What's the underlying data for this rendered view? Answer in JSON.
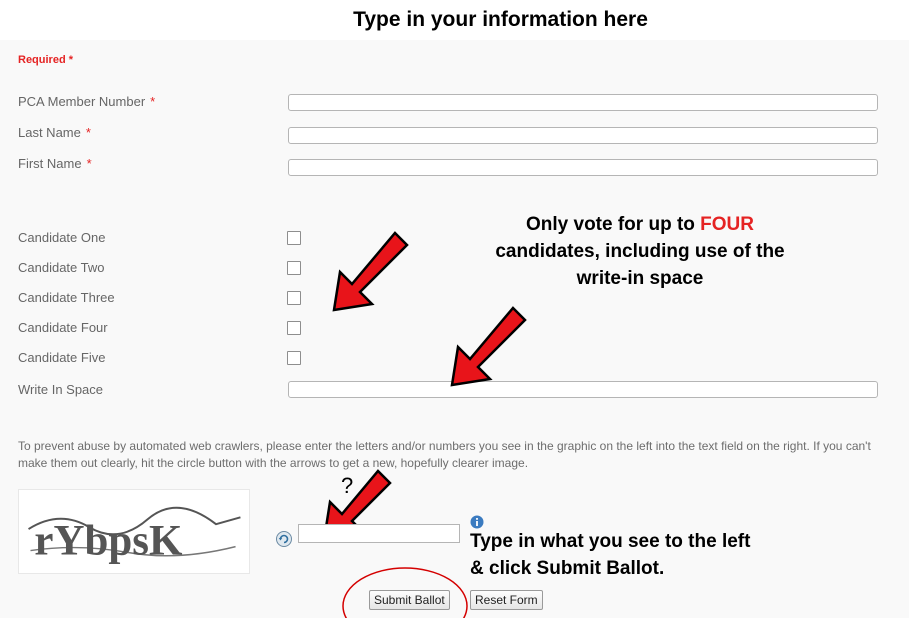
{
  "heading": "Type in your information here",
  "required_label": "Required *",
  "fields": [
    {
      "label": "PCA Member Number",
      "required": "*"
    },
    {
      "label": "Last Name",
      "required": "*"
    },
    {
      "label": "First Name",
      "required": "*"
    }
  ],
  "candidates": [
    {
      "label": "Candidate One",
      "checked": false
    },
    {
      "label": "Candidate Two",
      "checked": false
    },
    {
      "label": "Candidate Three",
      "checked": false
    },
    {
      "label": "Candidate Four",
      "checked": false
    },
    {
      "label": "Candidate Five",
      "checked": false
    }
  ],
  "write_in": {
    "label": "Write In Space"
  },
  "vote_note": {
    "part1": "Only vote for up to",
    "highlight": "FOUR",
    "line2": "candidates, including use of the",
    "line3": "write-in space"
  },
  "instruction": "To prevent abuse by automated web crawlers, please enter the letters and/or numbers you see in the graphic on the left into the text field on the right. If you can't make them out clearly, hit the circle button with the arrows to get a new, hopefully clearer image.",
  "captcha_text": "rYbpsK",
  "captcha_note": {
    "line1": "Type in what you see to the left",
    "line2": "& click Submit Ballot."
  },
  "question_mark": "?",
  "buttons": {
    "submit": "Submit Ballot",
    "reset": "Reset Form"
  },
  "colors": {
    "required": "#e52323",
    "arrow": "#e8141a",
    "highlight": "#e52323"
  }
}
